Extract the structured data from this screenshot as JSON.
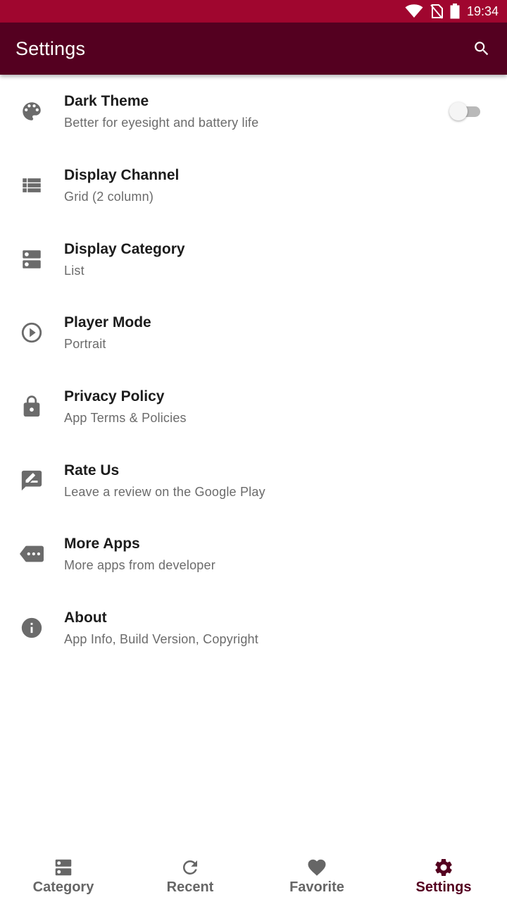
{
  "status_bar": {
    "time": "19:34"
  },
  "app_bar": {
    "title": "Settings",
    "search_icon": "search-icon"
  },
  "settings": [
    {
      "icon": "palette-icon",
      "title": "Dark Theme",
      "subtitle": "Better for eyesight and battery life",
      "toggle": {
        "on": false
      }
    },
    {
      "icon": "list-view-icon",
      "title": "Display Channel",
      "subtitle": "Grid (2 column)"
    },
    {
      "icon": "dns-icon",
      "title": "Display Category",
      "subtitle": "List"
    },
    {
      "icon": "play-circle-icon",
      "title": "Player Mode",
      "subtitle": "Portrait"
    },
    {
      "icon": "lock-icon",
      "title": "Privacy Policy",
      "subtitle": "App Terms & Policies"
    },
    {
      "icon": "rate-review-icon",
      "title": "Rate Us",
      "subtitle": "Leave a review on the Google Play"
    },
    {
      "icon": "more-tag-icon",
      "title": "More Apps",
      "subtitle": "More apps from developer"
    },
    {
      "icon": "info-icon",
      "title": "About",
      "subtitle": "App Info, Build Version, Copyright"
    }
  ],
  "bottom_nav": {
    "items": [
      {
        "icon": "category-icon",
        "label": "Category",
        "active": false
      },
      {
        "icon": "refresh-icon",
        "label": "Recent",
        "active": false
      },
      {
        "icon": "heart-icon",
        "label": "Favorite",
        "active": false
      },
      {
        "icon": "gear-icon",
        "label": "Settings",
        "active": true
      }
    ]
  },
  "colors": {
    "status_bar": "#a0062f",
    "app_bar": "#540020",
    "icon_gray": "#6b6b6b",
    "nav_active": "#540020",
    "nav_inactive": "#666666"
  }
}
